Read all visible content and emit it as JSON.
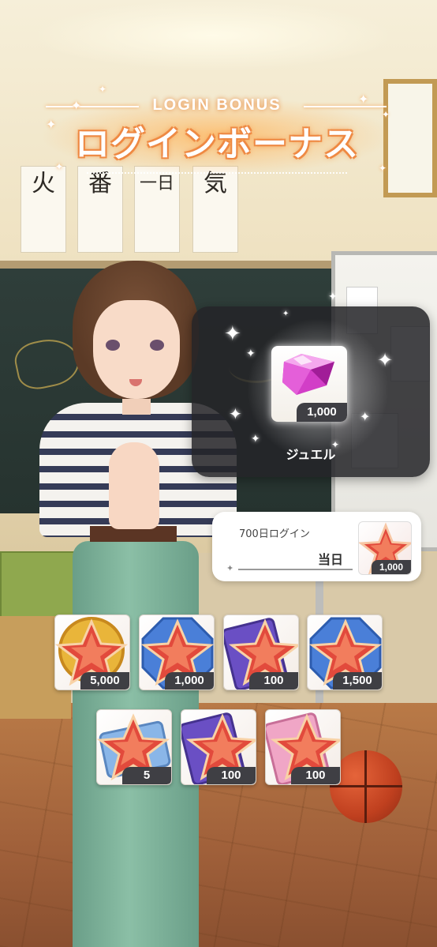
{
  "title": {
    "english": "LOGIN BONUS",
    "japanese": "ログインボーナス"
  },
  "background": {
    "scroll_chars": [
      "火",
      "番",
      "一日",
      "気"
    ]
  },
  "reward": {
    "item_icon": "jewel-icon",
    "quantity": "1,000",
    "name": "ジュエル"
  },
  "day_card": {
    "label": "700日ログイン",
    "status": "当日",
    "item_icon": "star-piece-icon",
    "quantity": "1,000"
  },
  "items_row1": [
    {
      "icon": "gold-medal-star-icon",
      "quantity": "5,000"
    },
    {
      "icon": "blue-octagon-star-icon",
      "quantity": "1,000"
    },
    {
      "icon": "purple-book-star-icon",
      "quantity": "100"
    },
    {
      "icon": "blue-octagon-star-icon",
      "quantity": "1,500"
    }
  ],
  "items_row2": [
    {
      "icon": "ticket-star-icon",
      "quantity": "5"
    },
    {
      "icon": "purple-book-star-icon",
      "quantity": "100"
    },
    {
      "icon": "pink-book-star-icon",
      "quantity": "100"
    }
  ]
}
